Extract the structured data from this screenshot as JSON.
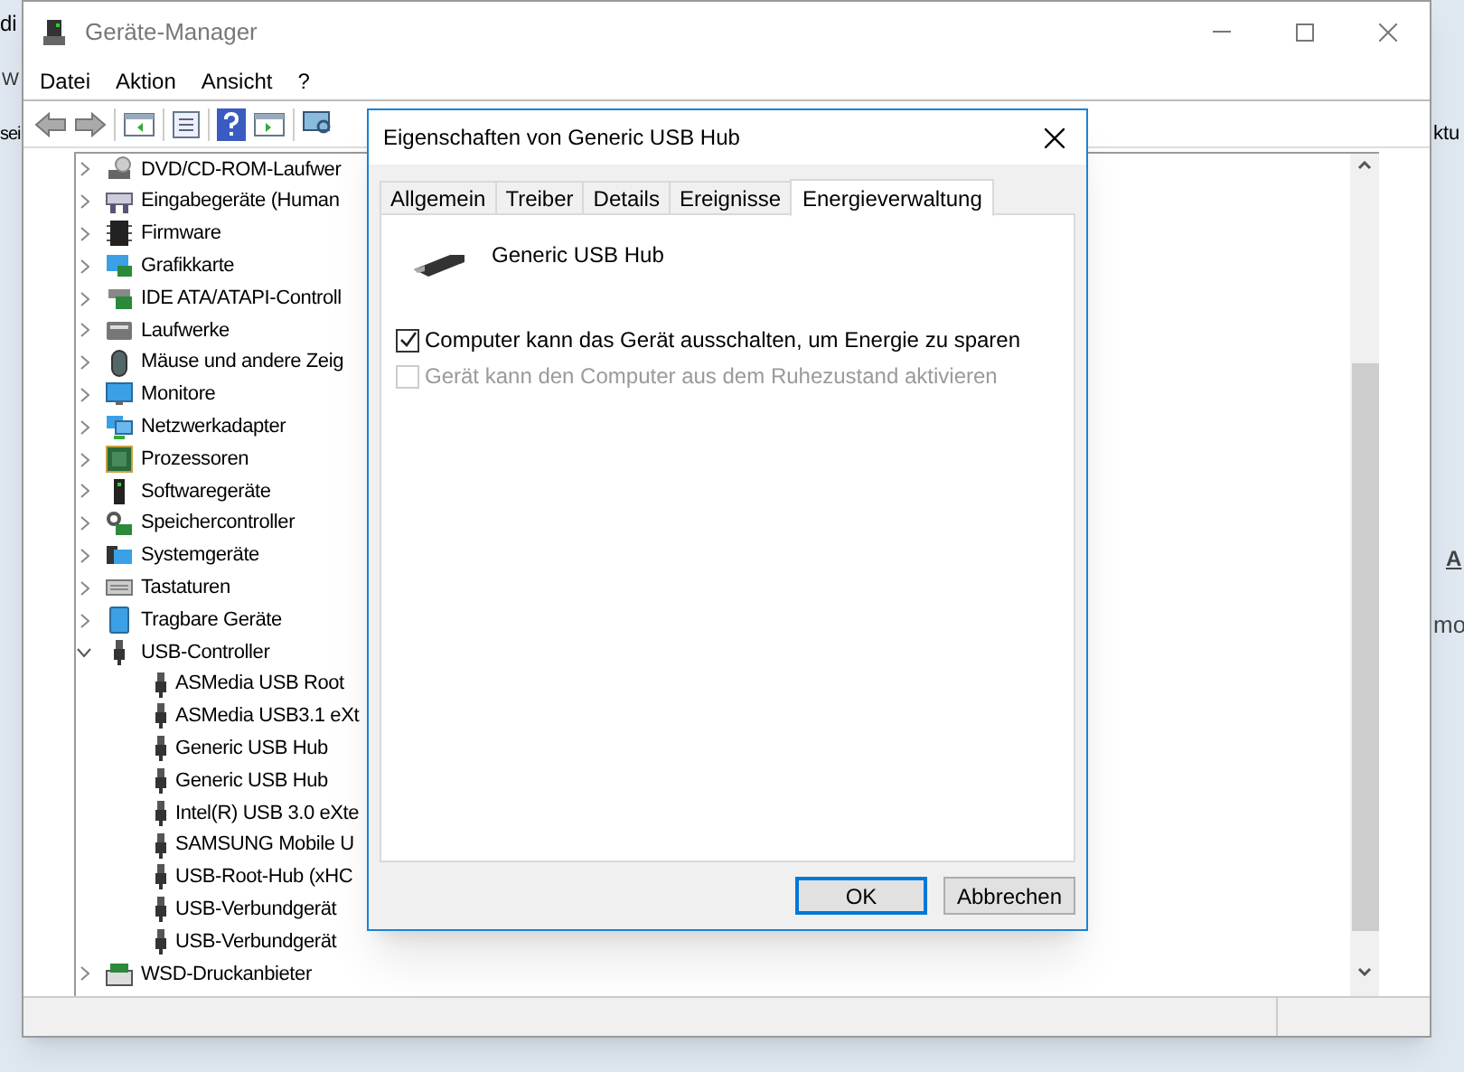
{
  "background_fragments": [
    "di",
    "W",
    "sei",
    "ktu",
    "A",
    "mo"
  ],
  "window": {
    "title": "Geräte-Manager"
  },
  "menu": [
    "Datei",
    "Aktion",
    "Ansicht",
    "?"
  ],
  "tree": [
    {
      "label": "DVD/CD-ROM-Laufwer",
      "expanded": false
    },
    {
      "label": "Eingabegeräte (Human",
      "expanded": false
    },
    {
      "label": "Firmware",
      "expanded": false
    },
    {
      "label": "Grafikkarte",
      "expanded": false
    },
    {
      "label": "IDE ATA/ATAPI-Controll",
      "expanded": false
    },
    {
      "label": "Laufwerke",
      "expanded": false
    },
    {
      "label": "Mäuse und andere Zeig",
      "expanded": false
    },
    {
      "label": "Monitore",
      "expanded": false
    },
    {
      "label": "Netzwerkadapter",
      "expanded": false
    },
    {
      "label": "Prozessoren",
      "expanded": false
    },
    {
      "label": "Softwaregeräte",
      "expanded": false
    },
    {
      "label": "Speichercontroller",
      "expanded": false
    },
    {
      "label": "Systemgeräte",
      "expanded": false
    },
    {
      "label": "Tastaturen",
      "expanded": false
    },
    {
      "label": "Tragbare Geräte",
      "expanded": false
    },
    {
      "label": "USB-Controller",
      "expanded": true,
      "children": [
        {
          "label": "ASMedia USB Root"
        },
        {
          "label": "ASMedia USB3.1 eXt"
        },
        {
          "label": "Generic USB Hub"
        },
        {
          "label": "Generic USB Hub"
        },
        {
          "label": "Intel(R) USB 3.0 eXte"
        },
        {
          "label": "SAMSUNG Mobile U"
        },
        {
          "label": "USB-Root-Hub (xHC"
        },
        {
          "label": "USB-Verbundgerät"
        },
        {
          "label": "USB-Verbundgerät"
        }
      ]
    },
    {
      "label": "WSD-Druckanbieter",
      "expanded": false
    }
  ],
  "dialog": {
    "title": "Eigenschaften von Generic USB Hub",
    "tabs": [
      {
        "label": "Allgemein",
        "selected": false
      },
      {
        "label": "Treiber",
        "selected": false
      },
      {
        "label": "Details",
        "selected": false
      },
      {
        "label": "Ereignisse",
        "selected": false
      },
      {
        "label": "Energieverwaltung",
        "selected": true
      }
    ],
    "device_name": "Generic USB Hub",
    "options": [
      {
        "label": "Computer kann das Gerät ausschalten, um Energie zu sparen",
        "checked": true,
        "disabled": false
      },
      {
        "label": "Gerät kann den Computer aus dem Ruhezustand aktivieren",
        "checked": false,
        "disabled": true
      }
    ],
    "buttons": [
      {
        "label": "OK",
        "selected": true
      },
      {
        "label": "Abbrechen",
        "selected": false
      }
    ]
  }
}
